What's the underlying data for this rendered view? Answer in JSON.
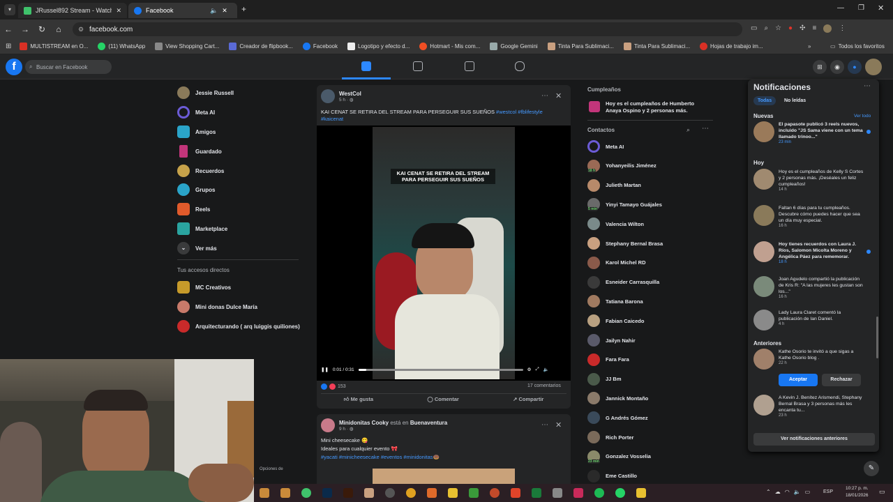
{
  "browser": {
    "tabs": [
      {
        "label": "JRussel892 Stream - Watch Live",
        "favicon_color": "#3fc26b"
      },
      {
        "label": "Facebook",
        "favicon_color": "#1877f2"
      }
    ],
    "url": "facebook.com",
    "bookmarks": [
      "MULTISTREAM en O...",
      "(11) WhatsApp",
      "View Shopping Cart...",
      "Creador de flipbook...",
      "Facebook",
      "Logotipo y efecto d...",
      "Hotmart - Mis com...",
      "Google Gemini",
      "Tinta Para Sublimaci...",
      "Tinta Para Sublimaci...",
      "Hojas de trabajo im..."
    ],
    "all_bookmarks": "Todos los favoritos"
  },
  "facebook": {
    "search_placeholder": "Buscar en Facebook",
    "left_menu": [
      {
        "label": "Jessie Russell",
        "icon": "profile-avatar",
        "color": "#8a7a5a"
      },
      {
        "label": "Meta AI",
        "icon": "meta-ai-icon",
        "color": "#6b5bd6"
      },
      {
        "label": "Amigos",
        "icon": "friends-icon",
        "color": "#2aa4c9"
      },
      {
        "label": "Guardado",
        "icon": "bookmark-icon",
        "color": "#c2357a"
      },
      {
        "label": "Recuerdos",
        "icon": "clock-icon",
        "color": "#c6a24a"
      },
      {
        "label": "Grupos",
        "icon": "groups-icon",
        "color": "#2aa4c9"
      },
      {
        "label": "Reels",
        "icon": "reels-icon",
        "color": "#e05a2b"
      },
      {
        "label": "Marketplace",
        "icon": "store-icon",
        "color": "#2aa4a0"
      },
      {
        "label": "Ver más",
        "icon": "chevron-down-icon",
        "color": "#3a3b3c"
      }
    ],
    "shortcuts_title": "Tus accesos directos",
    "shortcuts": [
      {
        "label": "MC Creativos",
        "color": "#c69a2a"
      },
      {
        "label": "Mini donas Dulce María",
        "color": "#c87a6a"
      },
      {
        "label": "Arquitecturando ( arq luiggis quiliones)",
        "color": "#c92a2a"
      }
    ],
    "post1": {
      "author": "WestCol",
      "time": "5 h",
      "text": "KAI CENAT SE RETIRA DEL STREAM PARA PERSEGUIR SUS SUEÑOS",
      "hashtags": "#westcol #fblifestyle #kaicenat",
      "video_caption": "KAI CENAT SE RETIRA DEL STREAM PARA PERSEGUIR SUS SUEÑOS",
      "video_time": "0:01 / 0:31",
      "progress": 0.05,
      "reactions": "153",
      "comments": "17 comentarios",
      "actions": [
        "Me gusta",
        "Comentar",
        "Compartir"
      ]
    },
    "post2": {
      "author": "Minidonitas Cooky",
      "location_prefix": "está en",
      "location": "Buenaventura",
      "time": "9 h",
      "lines": [
        "Mini cheesecake 😋",
        "Ideales para cualquier evento 🎀"
      ],
      "hashtags": "#yacati #minicheesecake #eventos #minidonitas🍩"
    },
    "birthdays": {
      "title": "Cumpleaños",
      "text": "Hoy es el cumpleaños de Humberto Anaya Ospino y 2 personas más."
    },
    "contacts_title": "Contactos",
    "contacts": [
      {
        "name": "Meta AI",
        "color": "#6b5bd6"
      },
      {
        "name": "Yohanyeilis Jiménez",
        "color": "#9a6a55",
        "badge": "18 h"
      },
      {
        "name": "Julieth Martan",
        "color": "#b88a6a"
      },
      {
        "name": "Yinyi Tamayo Guájales",
        "color": "#6a6a6a",
        "badge": "5 min"
      },
      {
        "name": "Valencia Wilton",
        "color": "#7a8a8a"
      },
      {
        "name": "Stephany Bernal Brasa",
        "color": "#c9a080"
      },
      {
        "name": "Karol Michel RD",
        "color": "#8a5a4a"
      },
      {
        "name": "Esneider Carrasquilla",
        "color": "#3a3a3a"
      },
      {
        "name": "Tatiana Barona",
        "color": "#a07a60"
      },
      {
        "name": "Fabian Caicedo",
        "color": "#b8a080"
      },
      {
        "name": "Jailyn Nahir",
        "color": "#5a5a6a"
      },
      {
        "name": "Fara Fara",
        "color": "#c92a2a"
      },
      {
        "name": "JJ Bm",
        "color": "#4a5a4a"
      },
      {
        "name": "Jannick Montaño",
        "color": "#8a7a6a"
      },
      {
        "name": "G Andrés Gómez",
        "color": "#3a4a5a"
      },
      {
        "name": "Rich Porter",
        "color": "#7a6a5a"
      },
      {
        "name": "Gonzalez Vosselia",
        "color": "#8a8a6a",
        "badge": "23 min"
      },
      {
        "name": "Eme Castillo",
        "color": "#2a2a2a"
      }
    ],
    "notifications": {
      "title": "Notificaciones",
      "filters": [
        "Todas",
        "No leídas"
      ],
      "section_new": "Nuevas",
      "see_all": "Ver todo",
      "section_today": "Hoy",
      "section_earlier": "Anteriores",
      "items": [
        {
          "text": "El papasote publicó 3 reels nuevos, incluido \"JS Sama viene con un tema llamado trinoo...\"",
          "time": "23 min",
          "color": "#9a7a5a",
          "unread": true
        },
        {
          "text": "Hoy es el cumpleaños de Kelly S Cortes y 2 personas más. ¡Deséales un feliz cumpleaños!",
          "time": "14 h",
          "color": "#a08a70",
          "unread": false
        },
        {
          "text": "Faltan 6 días para tu cumpleaños. Descubre cómo puedes hacer que sea un día muy especial.",
          "time": "16 h",
          "color": "#8a7a5a",
          "unread": false
        },
        {
          "text": "Hoy tienes recuerdos con Laura J. Ríos, Salomon Micolta Moreno y Angélica Páez para rememorar.",
          "time": "18 h",
          "color": "#c0a090",
          "unread": true
        },
        {
          "text": "Joan Agudelo compartió la publicación de Kris R: \"A las mujeres les gustan son los...\"",
          "time": "16 h",
          "color": "#7a8a7a",
          "unread": false
        },
        {
          "text": "Lady Laura Claret comentó la publicación de Ian Daniel.",
          "time": "4 h",
          "color": "#8a8a8a",
          "unread": false
        },
        {
          "text": "Kathe Osorio te invitó a que sigas a Kathe Osorio blog .",
          "time": "22 h",
          "color": "#a0806a",
          "unread": false
        },
        {
          "text": "A Kevin J. Benítez Arismendi, Stephany Bernal Brasa y 3 personas más les encanta tu...",
          "time": "23 h",
          "color": "#b0a090",
          "unread": false
        }
      ],
      "accept": "Aceptar",
      "reject": "Rechazar",
      "see_previous": "Ver notificaciones anteriores"
    }
  },
  "taskbar": {
    "lang": "ESP",
    "time": "10:27 p. m.",
    "date": "18/01/2026",
    "options_text": "Opciones de"
  }
}
